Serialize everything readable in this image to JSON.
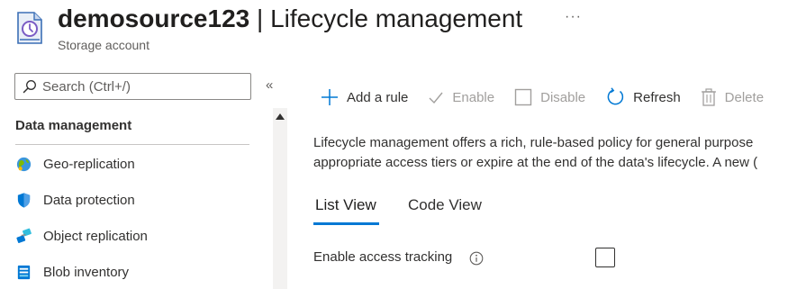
{
  "header": {
    "resource_name": "demosource123",
    "separator": " | ",
    "page_name": "Lifecycle management",
    "subtitle": "Storage account",
    "more_label": "···",
    "icon": "storage-lifecycle-icon"
  },
  "sidebar": {
    "search_placeholder": "Search (Ctrl+/)",
    "collapse_label": "«",
    "section_title": "Data management",
    "items": [
      {
        "label": "Geo-replication",
        "icon": "globe-icon"
      },
      {
        "label": "Data protection",
        "icon": "shield-icon"
      },
      {
        "label": "Object replication",
        "icon": "object-replication-icon"
      },
      {
        "label": "Blob inventory",
        "icon": "blob-inventory-icon"
      }
    ]
  },
  "toolbar": {
    "add_rule_label": "Add a rule",
    "enable_label": "Enable",
    "disable_label": "Disable",
    "refresh_label": "Refresh",
    "delete_label": "Delete"
  },
  "content": {
    "description_line1": "Lifecycle management offers a rich, rule-based policy for general purpose",
    "description_line2": "appropriate access tiers or expire at the end of the data's lifecycle. A new ("
  },
  "tabs": [
    {
      "label": "List View",
      "active": true
    },
    {
      "label": "Code View",
      "active": false
    }
  ],
  "settings": {
    "access_tracking_label": "Enable access tracking",
    "access_tracking_checked": false
  },
  "colors": {
    "accent": "#0078d4",
    "text": "#323130",
    "disabled_text": "#a19f9d"
  }
}
